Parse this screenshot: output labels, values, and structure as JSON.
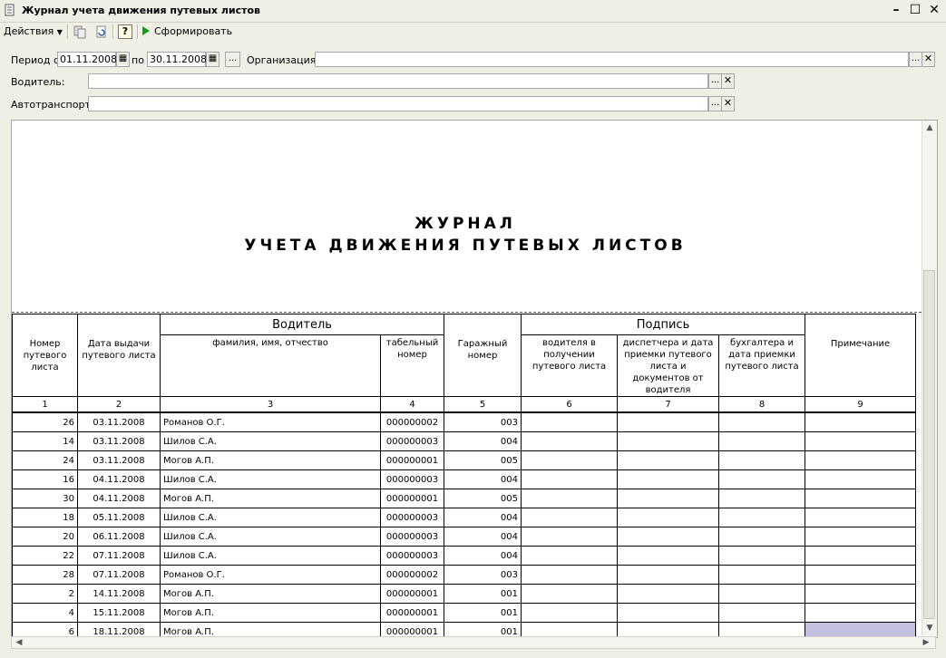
{
  "window": {
    "title": "Журнал учета движения путевых листов"
  },
  "toolbar": {
    "actions_label": "Действия",
    "form_label": "Сформировать",
    "help_label": "?"
  },
  "filters": {
    "period_from_label": "Период с",
    "period_from": "01.11.2008",
    "period_to_label": "по",
    "period_to": "30.11.2008",
    "org_label": "Организация:",
    "org_value": "",
    "driver_label": "Водитель:",
    "driver_value": "",
    "vehicle_label": "Автотранспорт:",
    "vehicle_value": "",
    "select_glyph": "...",
    "clear_glyph": "✕"
  },
  "report": {
    "title_line1": "ЖУРНАЛ",
    "title_line2": "УЧЕТА ДВИЖЕНИЯ ПУТЕВЫХ ЛИСТОВ",
    "headers": {
      "num": "Номер путевого листа",
      "date": "Дата выдачи путевого листа",
      "driver_group": "Водитель",
      "driver_name": "фамилия, имя, отчество",
      "driver_tab": "табельный номер",
      "garage": "Гаражный номер",
      "sign_group": "Подпись",
      "sign_driver": "водителя в получении путевого листа",
      "sign_dispatcher": "диспетчера и дата приемки путевого листа и документов от водителя",
      "sign_accountant": "бухгалтера и дата приемки путевого листа",
      "note": "Примечание"
    },
    "col_numbers": [
      "1",
      "2",
      "3",
      "4",
      "5",
      "6",
      "7",
      "8",
      "9"
    ],
    "rows": [
      {
        "num": "26",
        "date": "03.11.2008",
        "name": "Романов О.Г.",
        "tab": "000000002",
        "garage": "003"
      },
      {
        "num": "14",
        "date": "03.11.2008",
        "name": "Шилов С.А.",
        "tab": "000000003",
        "garage": "004"
      },
      {
        "num": "24",
        "date": "03.11.2008",
        "name": "Могов А.П.",
        "tab": "000000001",
        "garage": "005"
      },
      {
        "num": "16",
        "date": "04.11.2008",
        "name": "Шилов С.А.",
        "tab": "000000003",
        "garage": "004"
      },
      {
        "num": "30",
        "date": "04.11.2008",
        "name": "Могов А.П.",
        "tab": "000000001",
        "garage": "005"
      },
      {
        "num": "18",
        "date": "05.11.2008",
        "name": "Шилов С.А.",
        "tab": "000000003",
        "garage": "004"
      },
      {
        "num": "20",
        "date": "06.11.2008",
        "name": "Шилов С.А.",
        "tab": "000000003",
        "garage": "004"
      },
      {
        "num": "22",
        "date": "07.11.2008",
        "name": "Шилов С.А.",
        "tab": "000000003",
        "garage": "004"
      },
      {
        "num": "28",
        "date": "07.11.2008",
        "name": "Романов О.Г.",
        "tab": "000000002",
        "garage": "003"
      },
      {
        "num": "2",
        "date": "14.11.2008",
        "name": "Могов А.П.",
        "tab": "000000001",
        "garage": "001"
      },
      {
        "num": "4",
        "date": "15.11.2008",
        "name": "Могов А.П.",
        "tab": "000000001",
        "garage": "001"
      },
      {
        "num": "6",
        "date": "18.11.2008",
        "name": "Могов А.П.",
        "tab": "000000001",
        "garage": "001"
      }
    ]
  }
}
